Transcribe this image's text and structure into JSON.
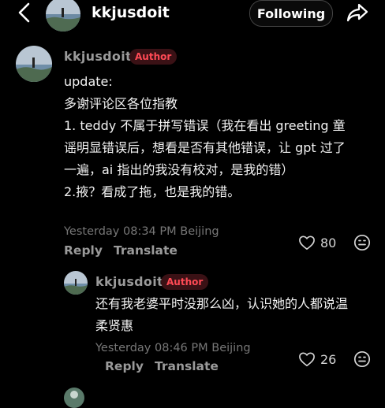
{
  "header": {
    "username": "kkjusdoit",
    "follow_label": "Following"
  },
  "comment": {
    "username": "kkjusdoit",
    "badge": "Author",
    "lines": [
      "update:",
      "多谢评论区各位指教",
      "1. teddy  不属于拼写错误（我在看出 greeting 童",
      "谣明显错误后，想看是否有其他错误，让 gpt 过了",
      "一遍，ai 指出的我没有校对，是我的错）",
      "2.掖？看成了拖，也是我的错。"
    ],
    "timestamp": "Yesterday 08:34 PM Beijing",
    "reply_label": "Reply",
    "translate_label": "Translate",
    "likes": "80"
  },
  "reply": {
    "username": "kkjusdoit",
    "badge": "Author",
    "lines": [
      "还有我老婆平时没那么凶，认识她的人都说温",
      "柔贤惠"
    ],
    "timestamp": "Yesterday 08:46 PM Beijing",
    "reply_label": "Reply",
    "translate_label": "Translate",
    "likes": "26"
  },
  "icons": {
    "back": "chevron-left-icon",
    "share": "share-arrow-icon",
    "like": "heart-outline-icon",
    "emoji": "emoji-face-icon"
  },
  "colors": {
    "background": "#000000",
    "author_badge_text": "#ff4a55",
    "author_badge_bg": "#3a1115"
  }
}
